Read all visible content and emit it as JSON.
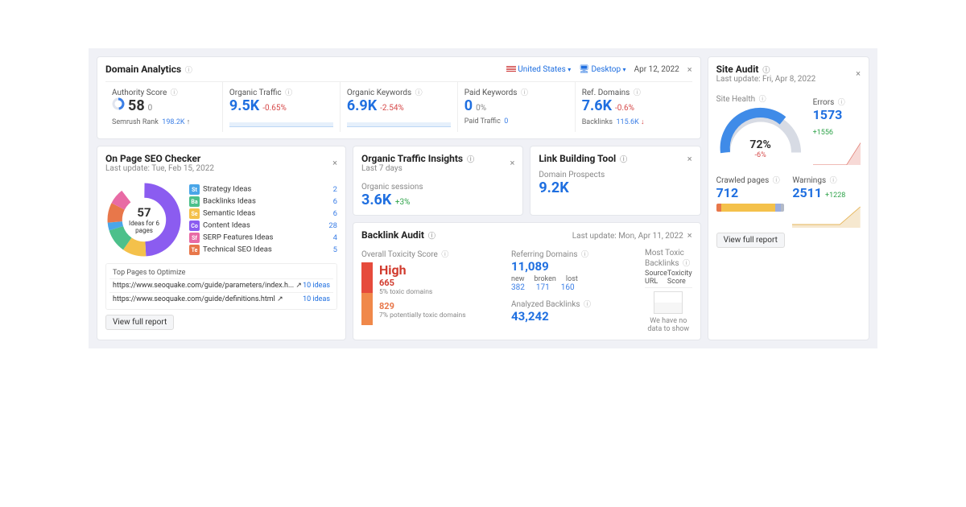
{
  "domain_analytics": {
    "title": "Domain Analytics",
    "filters": {
      "country": "United States",
      "device": "Desktop",
      "date": "Apr 12, 2022"
    },
    "cells": {
      "authority": {
        "label": "Authority Score",
        "value": "58",
        "sub": "0",
        "foot_label": "Semrush Rank",
        "foot_val": "198.2K"
      },
      "organic_traffic": {
        "label": "Organic Traffic",
        "value": "9.5K",
        "delta": "-0.65%"
      },
      "organic_keywords": {
        "label": "Organic Keywords",
        "value": "6.9K",
        "delta": "-2.54%"
      },
      "paid_keywords": {
        "label": "Paid Keywords",
        "value": "0",
        "delta": "0%",
        "foot_label": "Paid Traffic",
        "foot_val": "0"
      },
      "ref_domains": {
        "label": "Ref. Domains",
        "value": "7.6K",
        "delta": "-0.6%",
        "foot_label": "Backlinks",
        "foot_val": "115.6K"
      }
    }
  },
  "onpage": {
    "title": "On Page SEO Checker",
    "last_update": "Last update: Tue, Feb 15, 2022",
    "donut": {
      "total": "57",
      "caption": "Ideas for 6 pages"
    },
    "legend": [
      {
        "code": "St",
        "label": "Strategy Ideas",
        "count": "2",
        "color": "#4aa6e8"
      },
      {
        "code": "Ba",
        "label": "Backlinks Ideas",
        "count": "6",
        "color": "#4cc08b"
      },
      {
        "code": "Se",
        "label": "Semantic Ideas",
        "count": "6",
        "color": "#f4c14b"
      },
      {
        "code": "Co",
        "label": "Content Ideas",
        "count": "28",
        "color": "#8b5cf0"
      },
      {
        "code": "Sf",
        "label": "SERP Features Ideas",
        "count": "4",
        "color": "#e86ba5"
      },
      {
        "code": "Te",
        "label": "Technical SEO Ideas",
        "count": "5",
        "color": "#e8774a"
      }
    ],
    "top_pages_title": "Top Pages to Optimize",
    "top_pages": [
      {
        "url": "https://www.seoquake.com/guide/parameters/index.h...",
        "ideas": "10 ideas"
      },
      {
        "url": "https://www.seoquake.com/guide/definitions.html",
        "ideas": "10 ideas"
      }
    ],
    "view_report": "View full report"
  },
  "organic_insights": {
    "title": "Organic Traffic Insights",
    "sub": "Last 7 days",
    "label": "Organic sessions",
    "value": "3.6K",
    "delta": "+3%"
  },
  "link_building": {
    "title": "Link Building Tool",
    "label": "Domain Prospects",
    "value": "9.2K"
  },
  "site_audit": {
    "title": "Site Audit",
    "last_update": "Last update: Fri, Apr 8, 2022",
    "health": {
      "label": "Site Health",
      "value": "72%",
      "delta": "-6%"
    },
    "errors": {
      "label": "Errors",
      "value": "1573",
      "delta": "+1556"
    },
    "crawled": {
      "label": "Crawled pages",
      "value": "712"
    },
    "warnings": {
      "label": "Warnings",
      "value": "2511",
      "delta": "+1228"
    },
    "view_report": "View full report"
  },
  "backlink_audit": {
    "title": "Backlink Audit",
    "last_update": "Last update: Mon, Apr 11, 2022",
    "toxicity": {
      "label": "Overall Toxicity Score",
      "level": "High",
      "toxic_count": "665",
      "toxic_note": "5% toxic domains",
      "pot_count": "829",
      "pot_note": "7% potentially toxic domains"
    },
    "ref_domains": {
      "label": "Referring Domains",
      "value": "11,089",
      "new_label": "new",
      "new": "382",
      "broken_label": "broken",
      "broken": "171",
      "lost_label": "lost",
      "lost": "160"
    },
    "analyzed": {
      "label": "Analyzed Backlinks",
      "value": "43,242"
    },
    "most_toxic": {
      "label": "Most Toxic Backlinks",
      "col1": "Source URL",
      "col2": "Toxicity Score",
      "empty": "We have no data to show"
    }
  },
  "chart_data": [
    {
      "type": "pie",
      "title": "On Page SEO Ideas breakdown",
      "categories": [
        "Strategy Ideas",
        "Backlinks Ideas",
        "Semantic Ideas",
        "Content Ideas",
        "SERP Features Ideas",
        "Technical SEO Ideas"
      ],
      "values": [
        2,
        6,
        6,
        28,
        4,
        5
      ],
      "total": 57
    },
    {
      "type": "gauge",
      "title": "Site Health",
      "value": 72,
      "delta": -6,
      "range": [
        0,
        100
      ]
    }
  ]
}
